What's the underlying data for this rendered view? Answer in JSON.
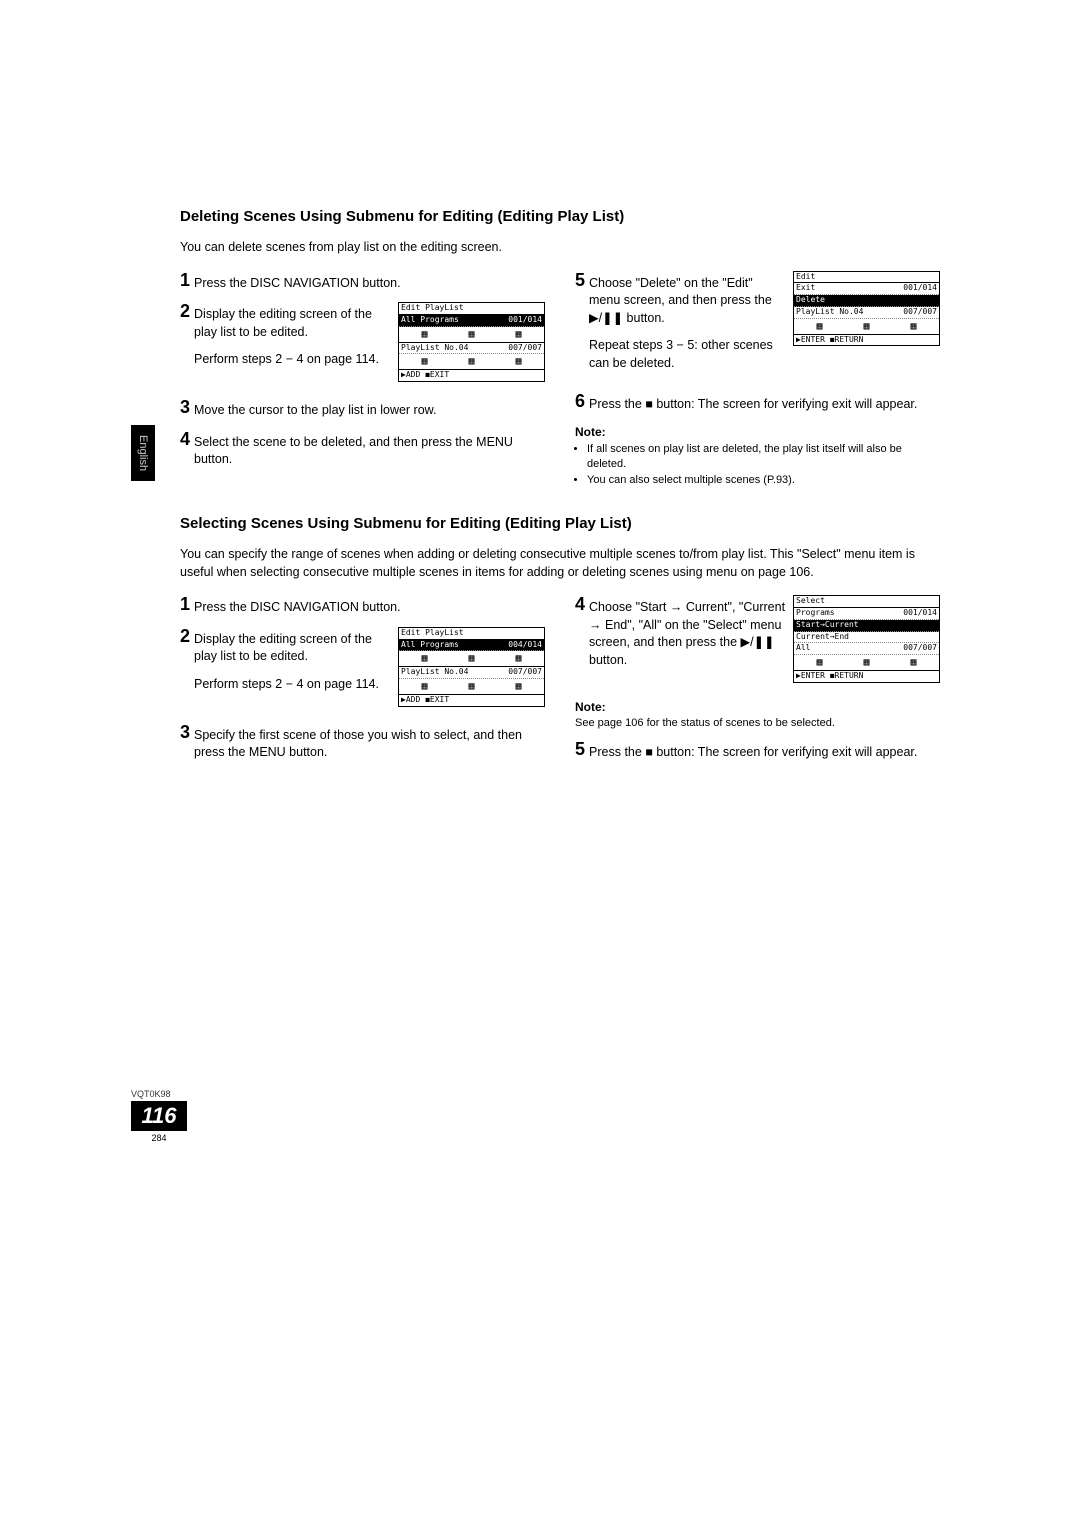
{
  "sideTab": "English",
  "docCode": "VQT0K98",
  "pageBig": "116",
  "pageSmall": "284",
  "section1": {
    "title": "Deleting Scenes Using Submenu for Editing (Editing Play List)",
    "intro": "You can delete scenes from play list on the editing screen.",
    "steps": {
      "s1": "Press the DISC NAVIGATION button.",
      "s2": "Display the editing screen of the play list to be edited.",
      "s2b": "Perform steps 2 − 4 on page 114.",
      "s3": "Move the cursor to the play list in lower row.",
      "s4": "Select the scene to be deleted, and then press the MENU button.",
      "s5a": "Choose \"Delete\" on the \"Edit\" menu screen, and then press the ",
      "s5b": " button.",
      "s5c": "Repeat steps 3 − 5: other scenes can be deleted.",
      "s6a": "Press the ",
      "s6b": " button: The screen for verifying exit will appear."
    },
    "note": "Note:",
    "notes": [
      "If all scenes on play list are deleted, the play list itself will also be deleted.",
      "You can also select multiple scenes (P.93)."
    ],
    "fig1": {
      "title": "Edit PlayList",
      "r1a": "All Programs",
      "r1b": "001/014",
      "r2a": "PlayList No.04",
      "r2b": "007/007",
      "btm": "▶ADD ◼EXIT"
    },
    "fig2": {
      "title": "Edit",
      "r1a": "Exit",
      "r1b": "001/014",
      "r2a": "Delete",
      "r3a": "PlayList No.04",
      "r3b": "007/007",
      "btm": "▶ENTER ◼RETURN"
    }
  },
  "section2": {
    "title": "Selecting Scenes Using Submenu for Editing (Editing Play List)",
    "intro": "You can specify the range of scenes when adding or deleting consecutive multiple scenes to/from play list. This \"Select\" menu item is useful when selecting consecutive multiple scenes in items for adding or deleting scenes using menu on page 106.",
    "steps": {
      "s1": "Press the DISC NAVIGATION button.",
      "s2": "Display the editing screen of the play list to be edited.",
      "s2b": "Perform steps 2 − 4 on page 114.",
      "s3": "Specify the first scene of those you wish to select, and then press the MENU button.",
      "s4a": "Choose \"Start → Current\", \"Current → End\", \"All\" on the \"Select\" menu screen, and then press the ",
      "s4b": " button.",
      "s5a": "Press the ",
      "s5b": " button: The screen for verifying exit will appear."
    },
    "note": "Note:",
    "noteText": "See page 106 for the status of scenes to be selected.",
    "fig1": {
      "title": "Edit PlayList",
      "r1a": "All Programs",
      "r1b": "004/014",
      "r2a": "PlayList No.04",
      "r2b": "007/007",
      "btm": "▶ADD ◼EXIT"
    },
    "fig2": {
      "title": "Select",
      "r1a": "Programs",
      "r1b": "001/014",
      "r2a": "Start→Current",
      "r3a": "Current→End",
      "r4a": "All",
      "r4b": "007/007",
      "btm": "▶ENTER ◼RETURN"
    }
  }
}
